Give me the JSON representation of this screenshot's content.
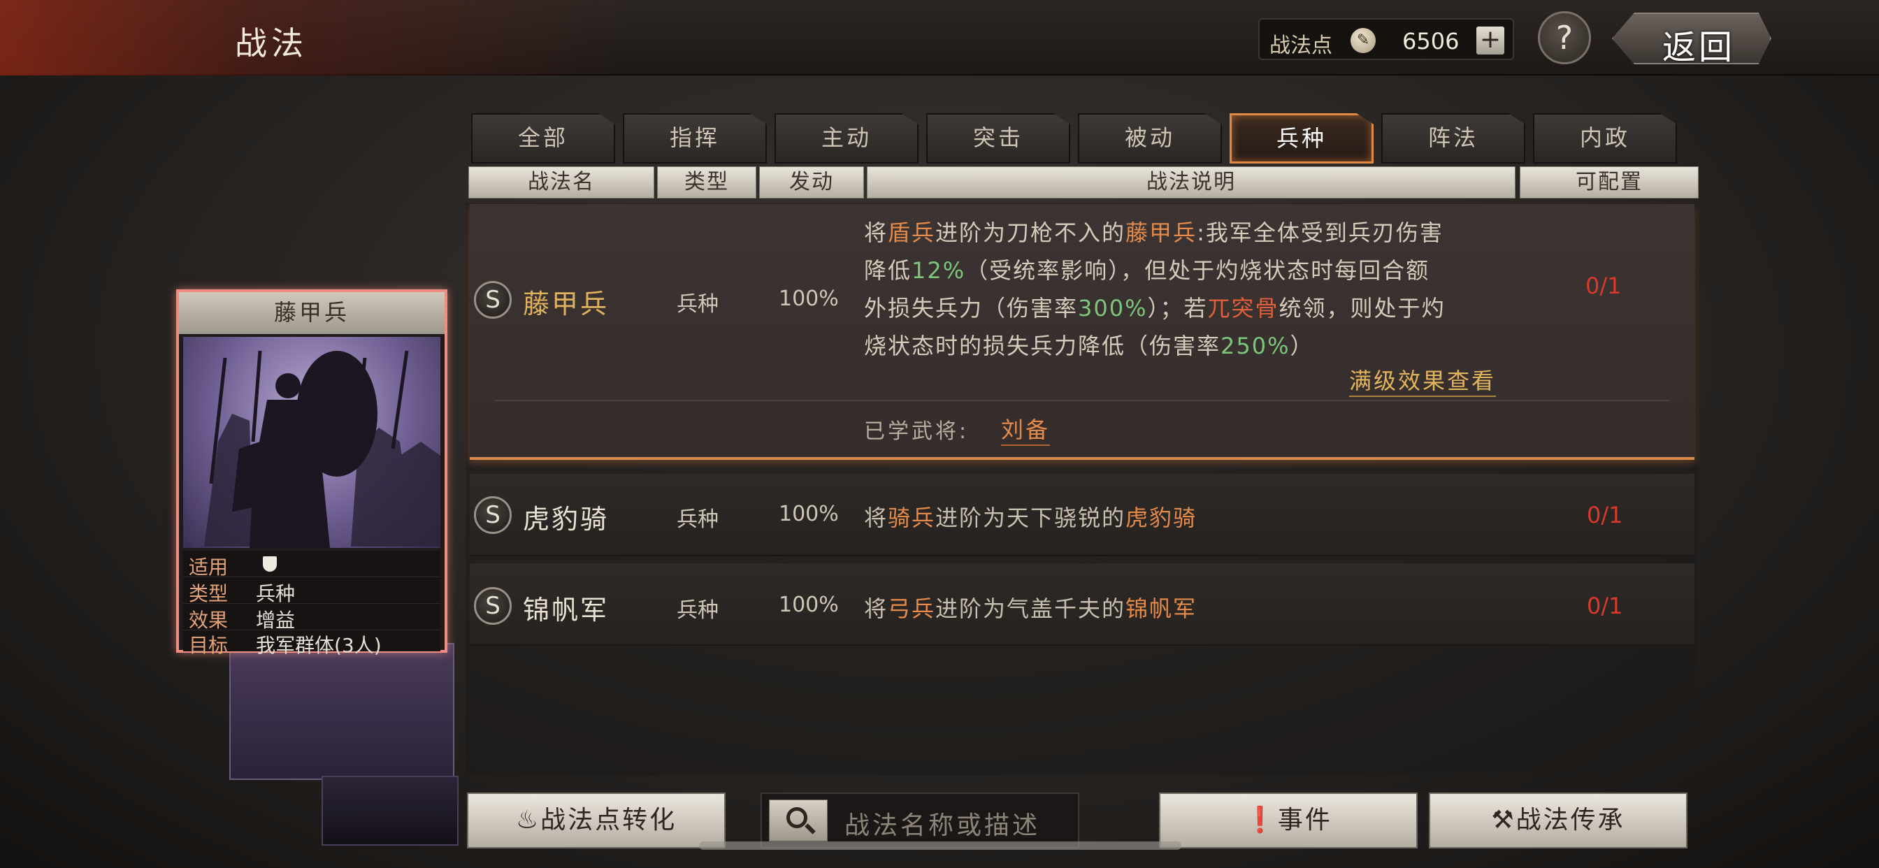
{
  "header": {
    "title": "战法",
    "points_label": "战法点",
    "points_value": "6506",
    "plus": "+",
    "help": "?",
    "back": "返回"
  },
  "tabs": [
    "全部",
    "指挥",
    "主动",
    "突击",
    "被动",
    "兵种",
    "阵法",
    "内政"
  ],
  "active_tab": "兵种",
  "columns": {
    "name": "战法名",
    "type": "类型",
    "trigger": "发动",
    "desc": "战法说明",
    "config": "可配置"
  },
  "skills": [
    {
      "grade": "S",
      "name": "藤甲兵",
      "type": "兵种",
      "rate": "100%",
      "config": "0/1",
      "desc": {
        "l1a": "将",
        "l1b": "盾兵",
        "l1c": "进阶为刀枪不入的",
        "l1d": "藤甲兵",
        "l1e": ":我军全体受到兵刃伤害",
        "l2a": "降低",
        "l2b": "12%",
        "l2c": "（受统率影响），但处于灼烧状态时每回合额",
        "l3a": "外损失兵力（伤害率",
        "l3b": "300%",
        "l3c": "）；若",
        "l3d": "兀突骨",
        "l3e": "统领，则处于灼",
        "l4a": "烧状态时的损失兵力降低（伤害率",
        "l4b": "250%",
        "l4c": "）"
      },
      "max_effect_link": "满级效果查看",
      "learned_label": "已学武将:",
      "learned_general": "刘备"
    },
    {
      "grade": "S",
      "name": "虎豹骑",
      "type": "兵种",
      "rate": "100%",
      "config": "0/1",
      "desc": {
        "a": "将",
        "b": "骑兵",
        "c": "进阶为天下骁锐的",
        "d": "虎豹骑"
      }
    },
    {
      "grade": "S",
      "name": "锦帆军",
      "type": "兵种",
      "rate": "100%",
      "config": "0/1",
      "desc": {
        "a": "将",
        "b": "弓兵",
        "c": "进阶为气盖千夫的",
        "d": "锦帆军"
      }
    }
  ],
  "card": {
    "title": "藤甲兵",
    "rows": [
      {
        "k": "适用",
        "v": ""
      },
      {
        "k": "类型",
        "v": "兵种"
      },
      {
        "k": "效果",
        "v": "增益"
      },
      {
        "k": "目标",
        "v": "我军群体(3人)"
      }
    ]
  },
  "bottom": {
    "convert": "战法点转化",
    "search_placeholder": "战法名称或描述",
    "events": "事件",
    "inherit": "战法传承"
  },
  "colors": {
    "accent_orange": "#e48a4a",
    "percent_green": "#7cc67a",
    "config_red": "#d93a2a",
    "card_border": "#f08d83"
  }
}
